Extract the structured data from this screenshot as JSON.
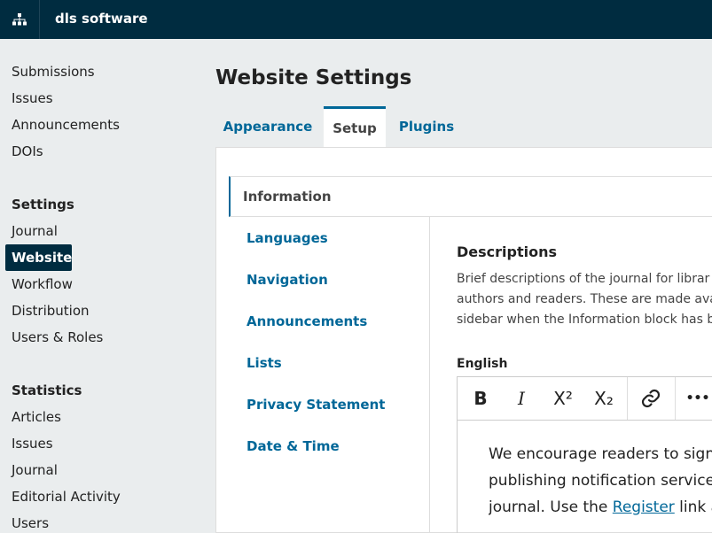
{
  "topbar": {
    "site_name": "dls software"
  },
  "sidebar": {
    "items": [
      "Submissions",
      "Issues",
      "Announcements",
      "DOIs"
    ],
    "settings_heading": "Settings",
    "settings_items": [
      "Journal",
      "Website",
      "Workflow",
      "Distribution",
      "Users & Roles"
    ],
    "statistics_heading": "Statistics",
    "statistics_items": [
      "Articles",
      "Issues",
      "Journal",
      "Editorial Activity",
      "Users"
    ],
    "active_item": "Website"
  },
  "main": {
    "title": "Website Settings",
    "tabs": [
      "Appearance",
      "Setup",
      "Plugins"
    ],
    "selected_tab": "Setup"
  },
  "subnav": {
    "items": [
      "Information",
      "Languages",
      "Navigation",
      "Announcements",
      "Lists",
      "Privacy Statement",
      "Date & Time"
    ],
    "current": "Information"
  },
  "content": {
    "section_title": "Descriptions",
    "section_desc_lines": [
      "Brief descriptions of the journal for librar",
      "authors and readers. These are made ava",
      "sidebar when the Information block has b"
    ],
    "field_label": "English",
    "editor_lines": [
      "We encourage readers to sign u",
      "publishing notification service f",
      "journal. Use the "
    ],
    "editor_link": "Register",
    "editor_line3_tail": " link at"
  },
  "toolbar": {
    "bold": "B",
    "italic": "I",
    "superscript": "X²",
    "subscript": "X₂",
    "more": "•••"
  },
  "colors": {
    "topbar": "#002c40",
    "accent": "#006798",
    "sidebar_bg": "#eaedee"
  }
}
